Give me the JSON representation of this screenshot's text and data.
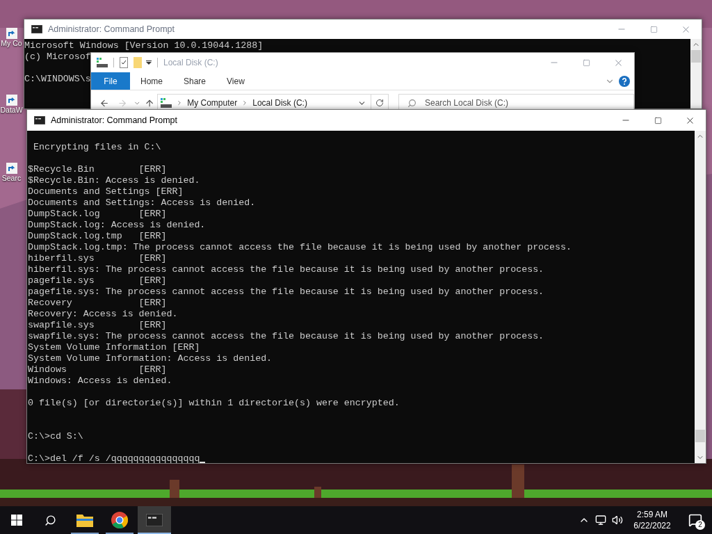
{
  "desktop": {
    "icons": [
      {
        "label": "My Co"
      },
      {
        "label": "DataW"
      },
      {
        "label": "Searc"
      }
    ]
  },
  "windows": [
    {
      "kind": "console",
      "title": "Administrator: Command Prompt",
      "active": false,
      "cursor": false,
      "lines": [
        {
          "kind": "text",
          "text": "Microsoft Windows [Version 10.0.19044.1288]"
        },
        {
          "kind": "text",
          "text": "(c) Microsof"
        },
        {
          "kind": "blank"
        },
        {
          "kind": "text",
          "text": "C:\\WINDOWS\\s"
        }
      ]
    },
    {
      "kind": "explorer",
      "title": "Local Disk (C:)",
      "active": false,
      "ribbon_tabs": [
        {
          "label": "File",
          "selected": true
        },
        {
          "label": "Home",
          "selected": false
        },
        {
          "label": "Share",
          "selected": false
        },
        {
          "label": "View",
          "selected": false
        }
      ],
      "breadcrumb": [
        "My Computer",
        "Local Disk (C:)"
      ],
      "search": {
        "placeholder": "Search Local Disk (C:)"
      }
    },
    {
      "kind": "console",
      "title": "Administrator: Command Prompt",
      "active": true,
      "cursor": true,
      "lines": [
        {
          "kind": "blank"
        },
        {
          "kind": "text",
          "text": " Encrypting files in C:\\"
        },
        {
          "kind": "blank"
        },
        {
          "kind": "text",
          "text": "$Recycle.Bin        [ERR]"
        },
        {
          "kind": "text",
          "text": "$Recycle.Bin: Access is denied."
        },
        {
          "kind": "text",
          "text": "Documents and Settings [ERR]"
        },
        {
          "kind": "text",
          "text": "Documents and Settings: Access is denied."
        },
        {
          "kind": "text",
          "text": "DumpStack.log       [ERR]"
        },
        {
          "kind": "text",
          "text": "DumpStack.log: Access is denied."
        },
        {
          "kind": "text",
          "text": "DumpStack.log.tmp   [ERR]"
        },
        {
          "kind": "text",
          "text": "DumpStack.log.tmp: The process cannot access the file because it is being used by another process."
        },
        {
          "kind": "text",
          "text": "hiberfil.sys        [ERR]"
        },
        {
          "kind": "text",
          "text": "hiberfil.sys: The process cannot access the file because it is being used by another process."
        },
        {
          "kind": "text",
          "text": "pagefile.sys        [ERR]"
        },
        {
          "kind": "text",
          "text": "pagefile.sys: The process cannot access the file because it is being used by another process."
        },
        {
          "kind": "text",
          "text": "Recovery            [ERR]"
        },
        {
          "kind": "text",
          "text": "Recovery: Access is denied."
        },
        {
          "kind": "text",
          "text": "swapfile.sys        [ERR]"
        },
        {
          "kind": "text",
          "text": "swapfile.sys: The process cannot access the file because it is being used by another process."
        },
        {
          "kind": "text",
          "text": "System Volume Information [ERR]"
        },
        {
          "kind": "text",
          "text": "System Volume Information: Access is denied."
        },
        {
          "kind": "text",
          "text": "Windows             [ERR]"
        },
        {
          "kind": "text",
          "text": "Windows: Access is denied."
        },
        {
          "kind": "blank"
        },
        {
          "kind": "text",
          "text": "0 file(s) [or directorie(s)] within 1 directorie(s) were encrypted."
        },
        {
          "kind": "blank"
        },
        {
          "kind": "blank"
        },
        {
          "kind": "text",
          "text": "C:\\>cd S:\\"
        },
        {
          "kind": "blank"
        },
        {
          "kind": "text",
          "text": "C:\\>del /f /s /qqqqqqqqqqqqqqqq"
        }
      ]
    }
  ],
  "taskbar": {
    "apps": [
      {
        "kind": "explorer",
        "selected": false
      },
      {
        "kind": "chrome",
        "selected": false
      },
      {
        "kind": "console",
        "selected": true
      }
    ],
    "time": "2:59 AM",
    "date": "6/22/2022",
    "notifications": "2"
  }
}
